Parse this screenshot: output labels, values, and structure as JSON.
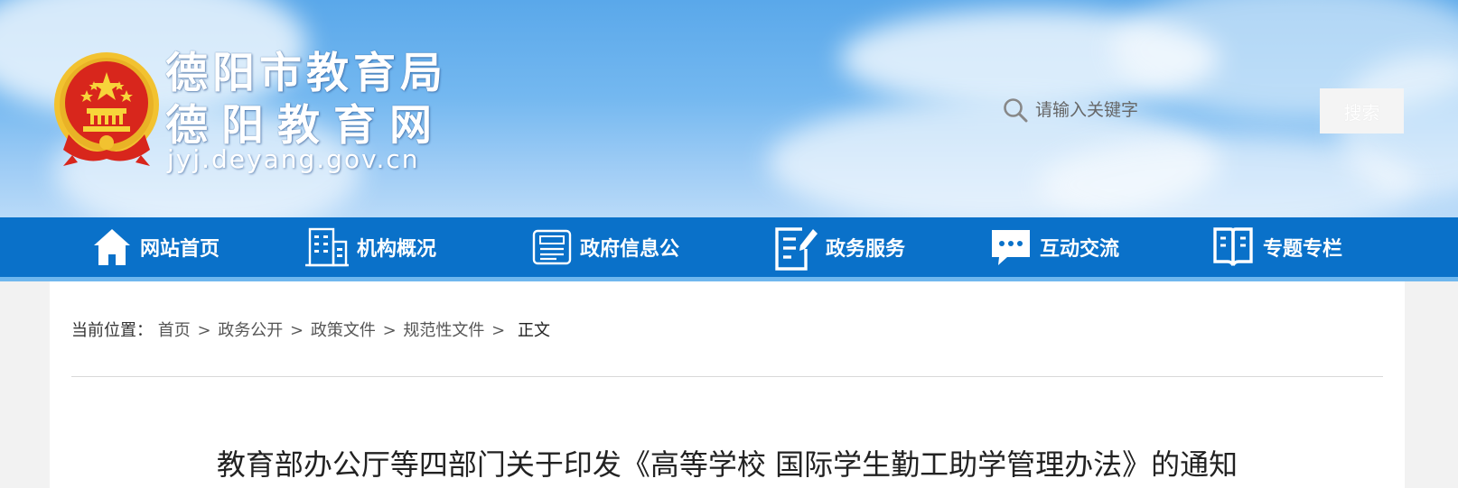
{
  "header": {
    "site_name_line1": "德阳市教育局",
    "site_name_line2": "德阳教育网",
    "site_url": "jyj.deyang.gov.cn",
    "search_placeholder": "请输入关键字",
    "search_button_label": "搜索"
  },
  "nav": {
    "items": [
      {
        "label": "网站首页",
        "icon": "home-icon"
      },
      {
        "label": "机构概况",
        "icon": "building-icon"
      },
      {
        "label": "政府信息公",
        "icon": "newspaper-icon"
      },
      {
        "label": "政务服务",
        "icon": "edit-document-icon"
      },
      {
        "label": "互动交流",
        "icon": "chat-bubble-icon"
      },
      {
        "label": "专题专栏",
        "icon": "open-book-icon"
      }
    ]
  },
  "breadcrumb": {
    "prefix": "当前位置：",
    "items": [
      "首页",
      "政务公开",
      "政策文件",
      "规范性文件"
    ],
    "current": "正文",
    "separator": ">"
  },
  "article": {
    "title": "教育部办公厅等四部门关于印发《高等学校 国际学生勤工助学管理办法》的通知"
  },
  "colors": {
    "nav_background": "#0a71c9",
    "header_sky": "#5aa8ea",
    "emblem_red": "#d8261c",
    "emblem_gold": "#f2c230"
  }
}
